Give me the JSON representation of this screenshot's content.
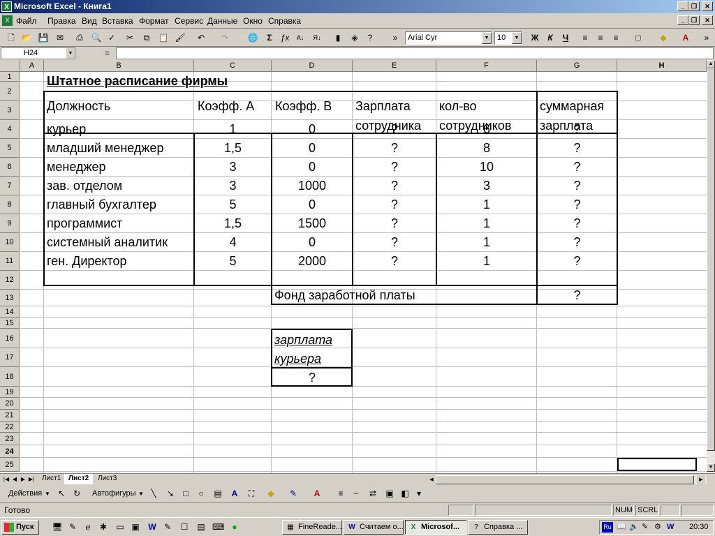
{
  "window": {
    "title": "Microsoft Excel - Книга1"
  },
  "menu": [
    "Файл",
    "Правка",
    "Вид",
    "Вставка",
    "Формат",
    "Сервис",
    "Данные",
    "Окно",
    "Справка"
  ],
  "toolbar": {
    "font": "Arial Cyr",
    "size": "10"
  },
  "formula": {
    "namebox": "H24",
    "eq": "="
  },
  "columns": [
    "A",
    "B",
    "C",
    "D",
    "E",
    "F",
    "G",
    "H"
  ],
  "rows": [
    "1",
    "2",
    "3",
    "4",
    "5",
    "6",
    "7",
    "8",
    "9",
    "10",
    "11",
    "12",
    "13",
    "14",
    "15",
    "16",
    "17",
    "18",
    "19",
    "20",
    "21",
    "22",
    "23",
    "24",
    "25"
  ],
  "sheet": {
    "title": "Штатное расписание фирмы",
    "headers": {
      "b": "Должность",
      "c": "Коэфф. А",
      "d": "Коэфф. В",
      "e1": "Зарплата",
      "e2": "сотрудника",
      "f1": "кол-во",
      "f2": "сотрудников",
      "g1": "суммарная",
      "g2": "зарплата"
    },
    "data": [
      {
        "b": "курьер",
        "c": "1",
        "d": "0",
        "e": "?",
        "f": "6",
        "g": "?"
      },
      {
        "b": "младший менеджер",
        "c": "1,5",
        "d": "0",
        "e": "?",
        "f": "8",
        "g": "?"
      },
      {
        "b": "менеджер",
        "c": "3",
        "d": "0",
        "e": "?",
        "f": "10",
        "g": "?"
      },
      {
        "b": "зав. отделом",
        "c": "3",
        "d": "1000",
        "e": "?",
        "f": "3",
        "g": "?"
      },
      {
        "b": "главный бухгалтер",
        "c": "5",
        "d": "0",
        "e": "?",
        "f": "1",
        "g": "?"
      },
      {
        "b": "программист",
        "c": "1,5",
        "d": "1500",
        "e": "?",
        "f": "1",
        "g": "?"
      },
      {
        "b": "системный аналитик",
        "c": "4",
        "d": "0",
        "e": "?",
        "f": "1",
        "g": "?"
      },
      {
        "b": "ген. Директор",
        "c": "5",
        "d": "2000",
        "e": "?",
        "f": "1",
        "g": "?"
      }
    ],
    "fund": {
      "label": "Фонд заработной платы",
      "value": "?"
    },
    "courier": {
      "line1": "зарплата",
      "line2": "курьера",
      "value": "?"
    }
  },
  "tabs": [
    "Лист1",
    "Лист2",
    "Лист3"
  ],
  "drawbar": {
    "actions": "Действия",
    "autoshapes": "Автофигуры"
  },
  "status": {
    "text": "Готово",
    "num": "NUM",
    "scrl": "SCRL"
  },
  "taskbar": {
    "start": "Пуск",
    "tasks": [
      "FineReade...",
      "Считаем о...",
      "Microsof...",
      "Справка ..."
    ],
    "lang": "Ru",
    "time": "20:30"
  }
}
